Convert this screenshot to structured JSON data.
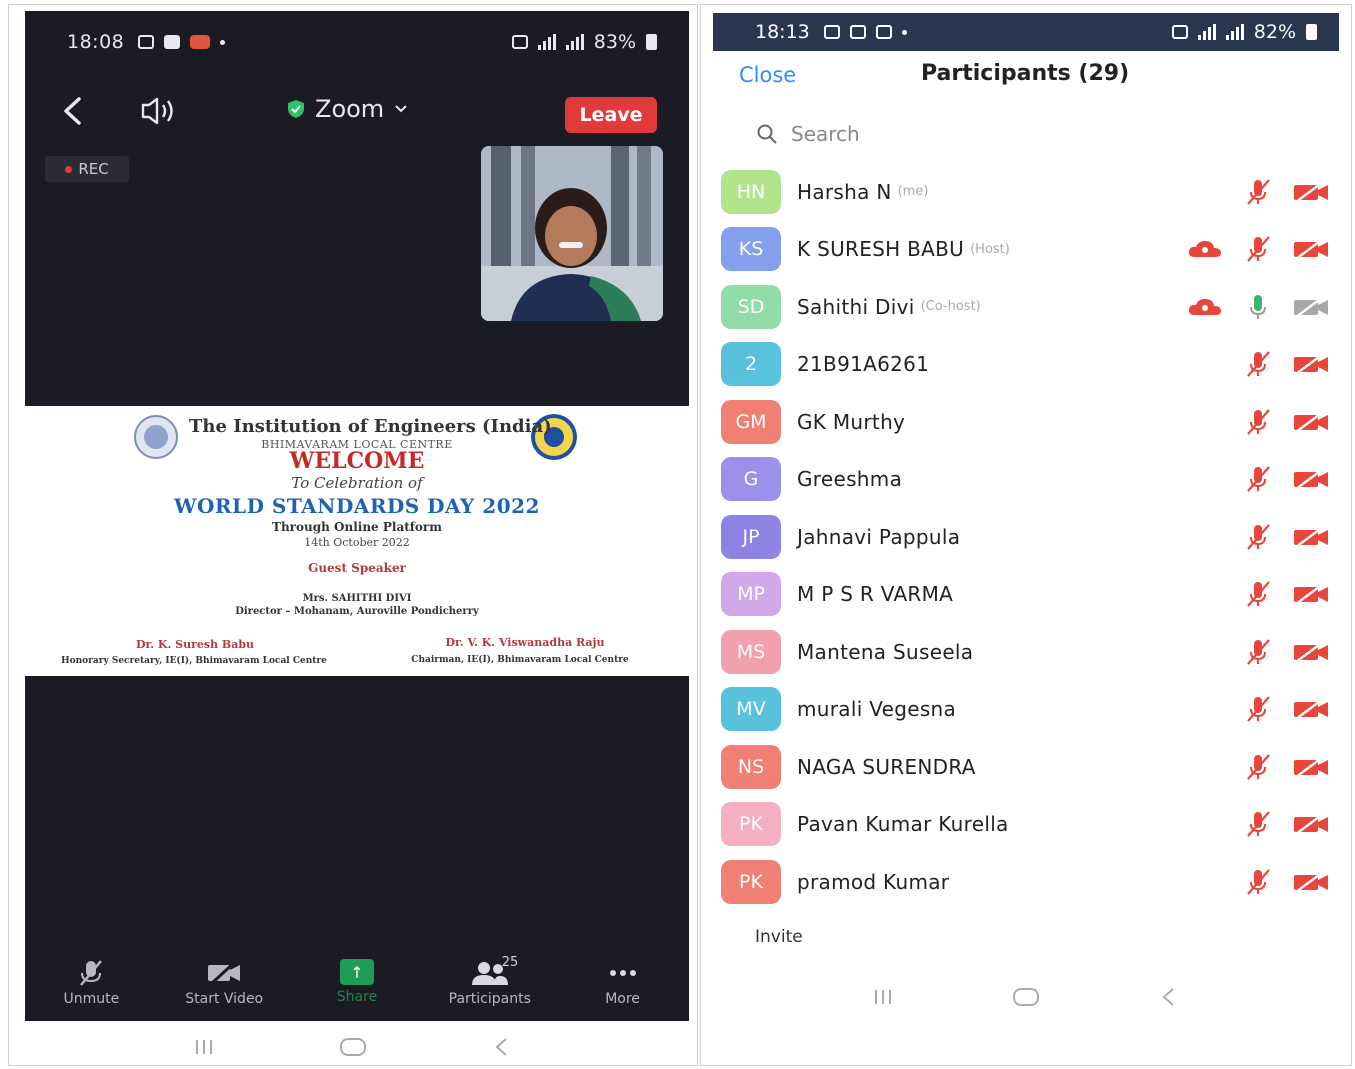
{
  "left": {
    "status": {
      "time": "18:08",
      "battery": "83%"
    },
    "topbar": {
      "app_title": "Zoom",
      "leave_label": "Leave",
      "rec_label": "REC"
    },
    "slide": {
      "org": "The Institution of Engineers (India)",
      "centre": "BHIMAVARAM LOCAL CENTRE",
      "welcome": "WELCOME",
      "celebration": "To Celebration of",
      "event": "WORLD STANDARDS DAY 2022",
      "platform": "Through Online Platform",
      "date": "14th October 2022",
      "guest_heading": "Guest Speaker",
      "speaker": "Mrs. SAHITHI DIVI",
      "designation": "Director – Mohanam, Auroville Pondicherry",
      "sig_left_name": "Dr. K. Suresh Babu",
      "sig_left_role": "Honorary Secretary, IE(I), Bhimavaram Local Centre",
      "sig_right_name": "Dr. V. K. Viswanadha Raju",
      "sig_right_role": "Chairman, IE(I), Bhimavaram Local Centre"
    },
    "bottombar": {
      "unmute": "Unmute",
      "start_video": "Start Video",
      "share": "Share",
      "participants": "Participants",
      "participants_count": "25",
      "more": "More"
    }
  },
  "right": {
    "status": {
      "time": "18:13",
      "battery": "82%"
    },
    "close_label": "Close",
    "title": "Participants (29)",
    "search_placeholder": "Search",
    "invite_label": "Invite",
    "participants": [
      {
        "initials": "HN",
        "name": "Harsha N",
        "tag": "(me)",
        "color": "#a6e07a",
        "cloud": false,
        "mic": "muted",
        "video": "off"
      },
      {
        "initials": "KS",
        "name": "K SURESH BABU",
        "tag": "(Host)",
        "color": "#6f8fe8",
        "cloud": true,
        "mic": "muted",
        "video": "off"
      },
      {
        "initials": "SD",
        "name": "Sahithi Divi",
        "tag": "(Co-host)",
        "color": "#7fd69a",
        "cloud": true,
        "mic": "on",
        "video": "off-gray"
      },
      {
        "initials": "2",
        "name": "21B91A6261",
        "tag": "",
        "color": "#3bb8d6",
        "cloud": false,
        "mic": "muted",
        "video": "off"
      },
      {
        "initials": "GM",
        "name": "GK Murthy",
        "tag": "",
        "color": "#ee6a5c",
        "cloud": false,
        "mic": "muted",
        "video": "off"
      },
      {
        "initials": "G",
        "name": "Greeshma",
        "tag": "",
        "color": "#8a7ce8",
        "cloud": false,
        "mic": "muted",
        "video": "off"
      },
      {
        "initials": "JP",
        "name": "Jahnavi Pappula",
        "tag": "",
        "color": "#7a6ee0",
        "cloud": false,
        "mic": "muted",
        "video": "off"
      },
      {
        "initials": "MP",
        "name": "M P S R VARMA",
        "tag": "",
        "color": "#c99be8",
        "cloud": false,
        "mic": "muted",
        "video": "off"
      },
      {
        "initials": "MS",
        "name": "Mantena Suseela",
        "tag": "",
        "color": "#f08fa0",
        "cloud": false,
        "mic": "muted",
        "video": "off"
      },
      {
        "initials": "MV",
        "name": "murali Vegesna",
        "tag": "",
        "color": "#3bb8d6",
        "cloud": false,
        "mic": "muted",
        "video": "off"
      },
      {
        "initials": "NS",
        "name": "NAGA SURENDRA",
        "tag": "",
        "color": "#ee6a5c",
        "cloud": false,
        "mic": "muted",
        "video": "off"
      },
      {
        "initials": "PK",
        "name": "Pavan Kumar Kurella",
        "tag": "",
        "color": "#f4a0b8",
        "cloud": false,
        "mic": "muted",
        "video": "off"
      },
      {
        "initials": "PK",
        "name": "pramod Kumar",
        "tag": "",
        "color": "#ee6a5c",
        "cloud": false,
        "mic": "muted",
        "video": "off"
      }
    ]
  },
  "colors": {
    "meeting_bg": "#1b1b24",
    "leave_red": "#e03a3a",
    "link_blue": "#2d8cff",
    "muted_red": "#e8463c",
    "share_green": "#1f9d55"
  }
}
